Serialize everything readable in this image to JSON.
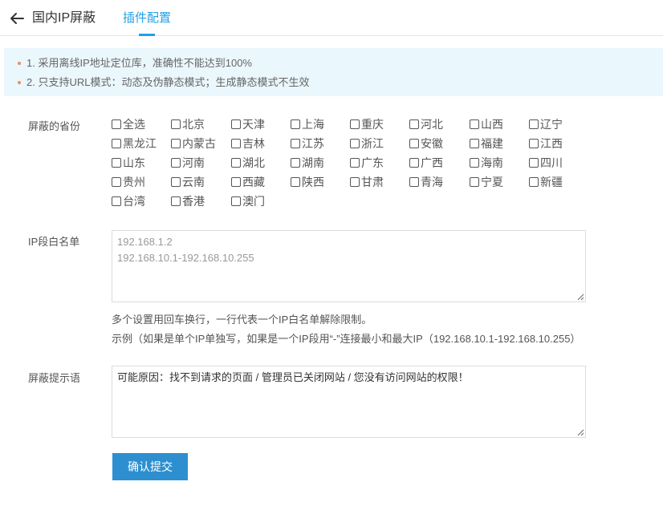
{
  "header": {
    "title": "国内IP屏蔽",
    "active_tab": "插件配置"
  },
  "notice": {
    "lines": [
      "1. 采用离线IP地址定位库，准确性不能达到100%",
      "2. 只支持URL模式：动态及伪静态模式；生成静态模式不生效"
    ]
  },
  "provinces": {
    "label": "屏蔽的省份",
    "items": [
      "全选",
      "北京",
      "天津",
      "上海",
      "重庆",
      "河北",
      "山西",
      "辽宁",
      "黑龙江",
      "内蒙古",
      "吉林",
      "江苏",
      "浙江",
      "安徽",
      "福建",
      "江西",
      "山东",
      "河南",
      "湖北",
      "湖南",
      "广东",
      "广西",
      "海南",
      "四川",
      "贵州",
      "云南",
      "西藏",
      "陕西",
      "甘肃",
      "青海",
      "宁夏",
      "新疆",
      "台湾",
      "香港",
      "澳门"
    ]
  },
  "whitelist": {
    "label": "IP段白名单",
    "placeholder_lines": [
      "192.168.1.2",
      "192.168.10.1-192.168.10.255"
    ],
    "hint1": "多个设置用回车换行，一行代表一个IP白名单解除限制。",
    "hint2": "示例（如果是单个IP单独写，如果是一个IP段用“-”连接最小和最大IP（192.168.10.1-192.168.10.255）"
  },
  "message": {
    "label": "屏蔽提示语",
    "value": "可能原因：找不到请求的页面 / 管理员已关闭网站 / 您没有访问网站的权限！"
  },
  "submit": {
    "label": "确认提交"
  },
  "colors": {
    "accent": "#20a0e8",
    "button": "#2d8fd0",
    "notice_bg": "#eaf7fd",
    "notice_dot": "#f08c5a"
  }
}
